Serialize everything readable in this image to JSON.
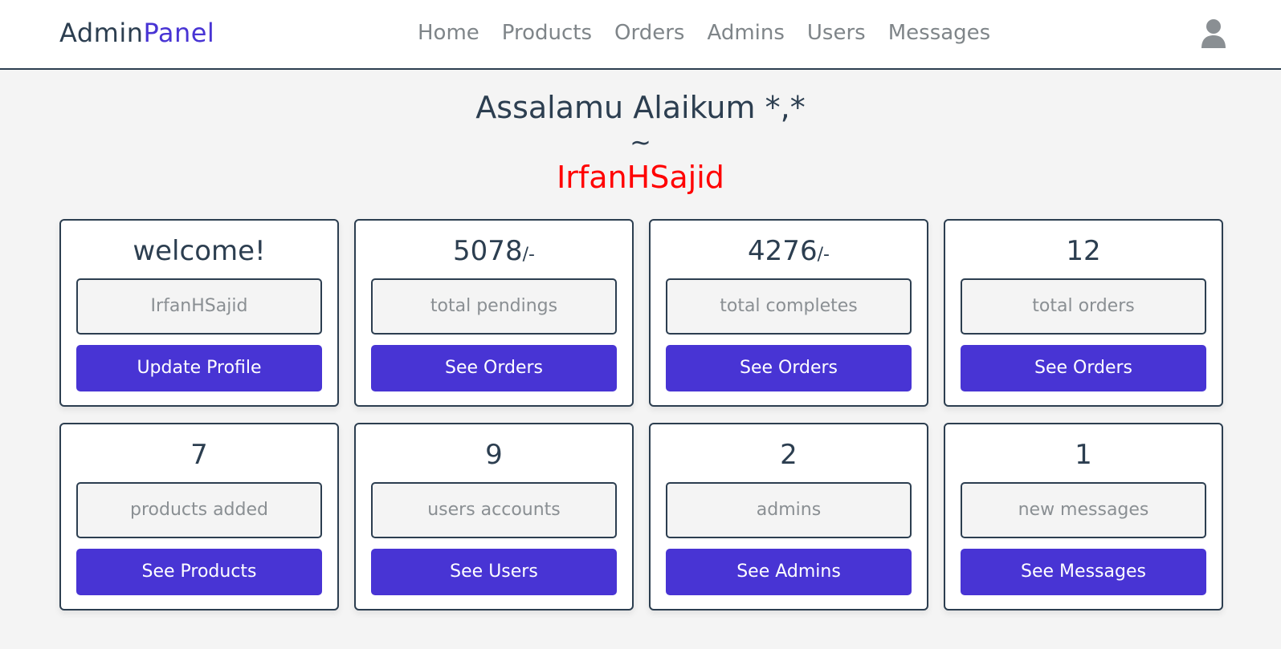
{
  "header": {
    "logo_main": "Admin",
    "logo_accent": "Panel",
    "nav": [
      "Home",
      "Products",
      "Orders",
      "Admins",
      "Users",
      "Messages"
    ],
    "user_icon": "user-icon"
  },
  "greeting": {
    "line1": "Assalamu Alaikum *,*",
    "tilde": "~",
    "name": "IrfanHSajid"
  },
  "cards": [
    {
      "value": "welcome!",
      "suffix": "",
      "label": "IrfanHSajid",
      "button": "Update Profile"
    },
    {
      "value": "5078",
      "suffix": "/-",
      "label": "total pendings",
      "button": "See Orders"
    },
    {
      "value": "4276",
      "suffix": "/-",
      "label": "total completes",
      "button": "See Orders"
    },
    {
      "value": "12",
      "suffix": "",
      "label": "total orders",
      "button": "See Orders"
    },
    {
      "value": "7",
      "suffix": "",
      "label": "products added",
      "button": "See Products"
    },
    {
      "value": "9",
      "suffix": "",
      "label": "users accounts",
      "button": "See Users"
    },
    {
      "value": "2",
      "suffix": "",
      "label": "admins",
      "button": "See Admins"
    },
    {
      "value": "1",
      "suffix": "",
      "label": "new messages",
      "button": "See Messages"
    }
  ],
  "colors": {
    "accent": "#4834d4",
    "text": "#2c3e50",
    "name": "#ff0000",
    "background": "#f4f4f4"
  }
}
